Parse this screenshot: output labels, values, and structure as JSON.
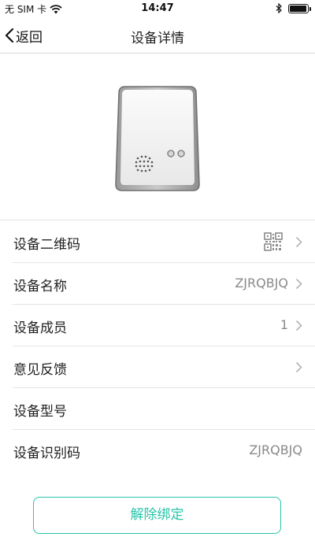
{
  "status_bar": {
    "carrier": "无 SIM 卡",
    "time": "14:47",
    "battery_level": 0.95,
    "icons": [
      "wifi-icon",
      "bluetooth-icon",
      "battery-icon"
    ]
  },
  "nav": {
    "back_label": "返回",
    "title": "设备详情"
  },
  "device": {
    "image_icon": "device-sensor-icon"
  },
  "rows": [
    {
      "label": "设备二维码",
      "value": "",
      "icon": "qr-code-icon",
      "has_arrow": true
    },
    {
      "label": "设备名称",
      "value": "ZJRQBJQ",
      "has_arrow": true
    },
    {
      "label": "设备成员",
      "value": "1",
      "has_arrow": true
    },
    {
      "label": "意见反馈",
      "value": "",
      "has_arrow": true
    },
    {
      "label": "设备型号",
      "value": "",
      "has_arrow": false
    },
    {
      "label": "设备识别码",
      "value": "ZJRQBJQ",
      "has_arrow": false
    }
  ],
  "actions": {
    "unbind_label": "解除绑定"
  },
  "colors": {
    "accent": "#29c4a9",
    "value_text": "#8a8a8a",
    "divider": "#e4e4e4"
  }
}
